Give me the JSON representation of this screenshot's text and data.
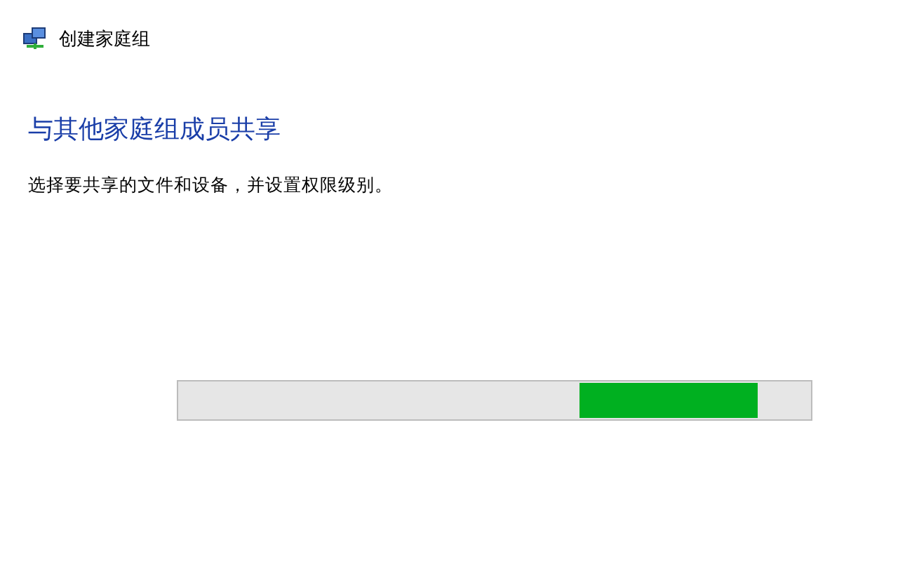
{
  "window": {
    "title": "创建家庭组"
  },
  "heading": "与其他家庭组成员共享",
  "instruction": "选择要共享的文件和设备，并设置权限级别。",
  "progress": {
    "kind": "marquee"
  }
}
